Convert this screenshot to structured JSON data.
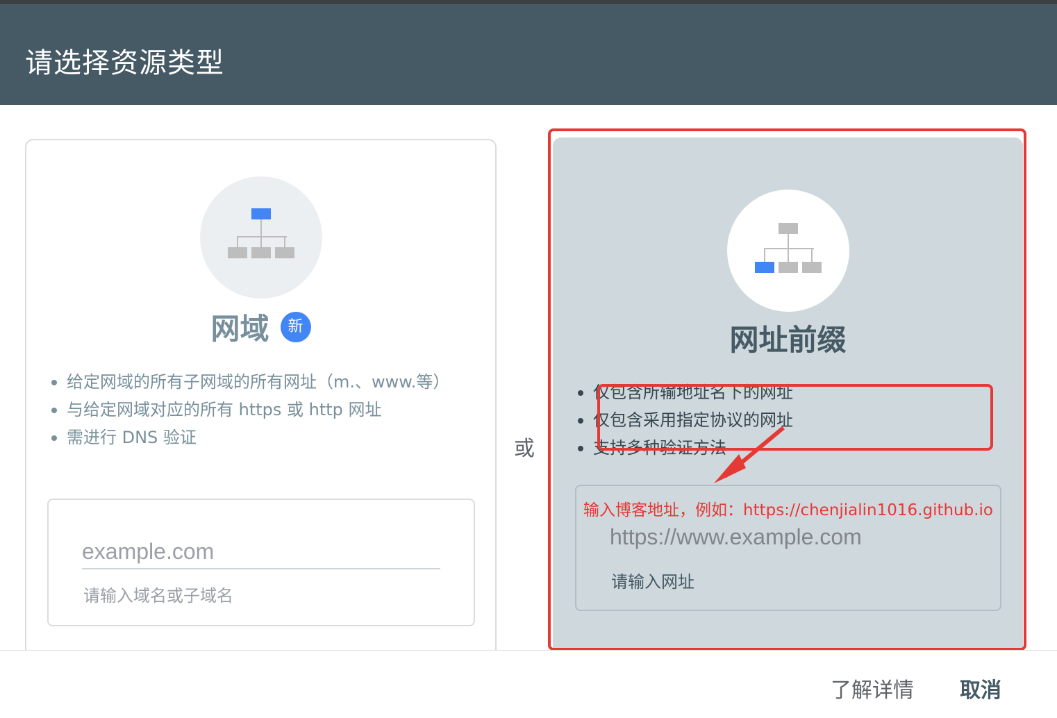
{
  "dialog": {
    "title": "请选择资源类型"
  },
  "domain_card": {
    "icon": "sitemap-icon",
    "title": "网域",
    "badge": "新",
    "bullets": [
      "给定网域的所有子网域的所有网址（m.、www.等）",
      "与给定网域对应的所有 https 或 http 网址",
      "需进行 DNS 验证"
    ],
    "input_placeholder": "example.com",
    "input_helper": "请输入域名或子域名"
  },
  "separator": "或",
  "url_prefix_card": {
    "icon": "sitemap-icon",
    "title": "网址前缀",
    "bullets": [
      "仅包含所输地址名下的网址",
      "仅包含采用指定协议的网址",
      "支持多种验证方法"
    ],
    "input_placeholder": "https://www.example.com",
    "input_helper": "请输入网址"
  },
  "annotation": {
    "text": "输入博客地址，例如：https://chenjialin1016.github.io",
    "color": "#e53935"
  },
  "footer": {
    "learn_more": "了解详情",
    "cancel": "取消"
  },
  "colors": {
    "header_bg": "#455a64",
    "accent_blue": "#4285f4",
    "selected_card_bg": "#cfd8dc"
  }
}
